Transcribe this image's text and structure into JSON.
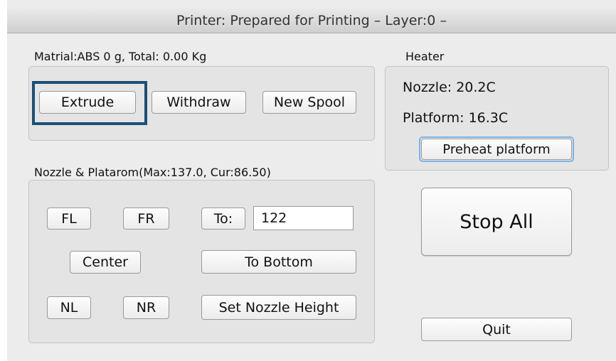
{
  "window": {
    "title": "Printer: Prepared for Printing – Layer:0 –"
  },
  "material": {
    "label": "Matrial:ABS 0 g,  Total: 0.00 Kg",
    "buttons": {
      "extrude": "Extrude",
      "withdraw": "Withdraw",
      "new_spool": "New Spool"
    }
  },
  "heater": {
    "label": "Heater",
    "nozzle": "Nozzle: 20.2C",
    "platform": "Platform: 16.3C",
    "preheat_button": "Preheat platform"
  },
  "nozzle_platform": {
    "label": "Nozzle & Platarom(Max:137.0, Cur:86.50)",
    "buttons": {
      "fl": "FL",
      "fr": "FR",
      "to": "To:",
      "center": "Center",
      "to_bottom": "To Bottom",
      "nl": "NL",
      "nr": "NR",
      "set_nozzle_height": "Set Nozzle  Height"
    },
    "to_value": "122"
  },
  "actions": {
    "stop_all": "Stop All",
    "quit": "Quit"
  },
  "colors": {
    "focus_ring": "#1b4f78",
    "window_bg": "#ececec"
  }
}
